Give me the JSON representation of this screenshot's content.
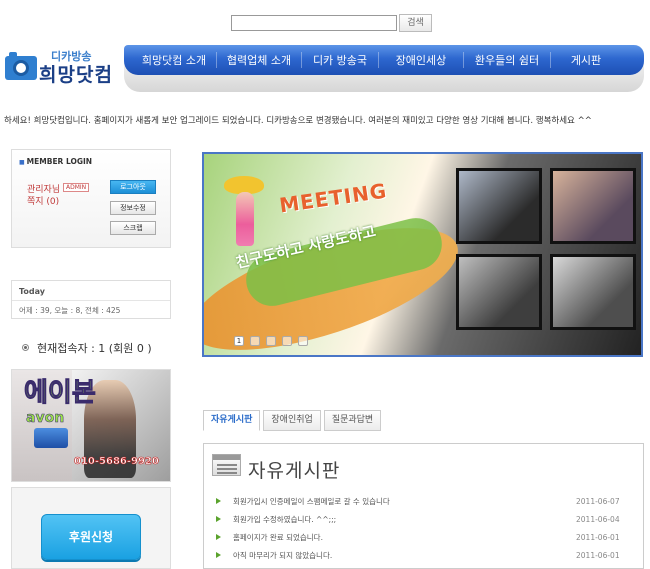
{
  "search": {
    "button_label": "검색"
  },
  "logo": {
    "subtitle": "디카방송",
    "name": "희망닷컴"
  },
  "nav": {
    "items": [
      "희망닷컴 소개",
      "협력업체 소개",
      "디카 방송국",
      "장애인세상",
      "환우들의 쉼터",
      "게시판"
    ]
  },
  "marquee": "하세요! 희망닷컴입니다. 홈페이지가 새롭게 보안 업그레이드 되었습니다. 디카방송으로 변경됐습니다. 여러분의 재미있고 다양한 영상 기대해 봅니다. 행복하세요 ^^",
  "login": {
    "title": "MEMBER LOGIN",
    "user": "관리자님",
    "badge": "ADMIN",
    "note": "쪽지 (0)",
    "buttons": {
      "logout": "로그아웃",
      "edit": "정보수정",
      "scrap": "스크랩"
    }
  },
  "today": {
    "title": "Today",
    "stats": "어제 : 39, 오늘 : 8, 전체 : 425"
  },
  "online": "현재접속자 : 1 (회원 0 )",
  "ad": {
    "title": "에이본",
    "brand": "avon",
    "phone": "010-5686-9920"
  },
  "donate": {
    "button": "후원신청"
  },
  "banner": {
    "headline": "MEETING",
    "slogan": "친구도하고 사랑도하고",
    "dots": [
      "1",
      "",
      "",
      "",
      ""
    ]
  },
  "tabs": [
    {
      "label": "자유게시판",
      "active": true
    },
    {
      "label": "장애인취업",
      "active": false
    },
    {
      "label": "질문과답변",
      "active": false
    }
  ],
  "board": {
    "title": "자유게시판",
    "posts": [
      {
        "subject": "회원가입시 인증메일이 스팸메일로 갈 수 있습니다",
        "date": "2011-06-07"
      },
      {
        "subject": "회원가입 수정하였습니다. ^^;;;",
        "date": "2011-06-04"
      },
      {
        "subject": "홈페이지가 완료 되었습니다.",
        "date": "2011-06-01"
      },
      {
        "subject": "아직 마무리가 되지 않았습니다.",
        "date": "2011-06-01"
      }
    ]
  }
}
